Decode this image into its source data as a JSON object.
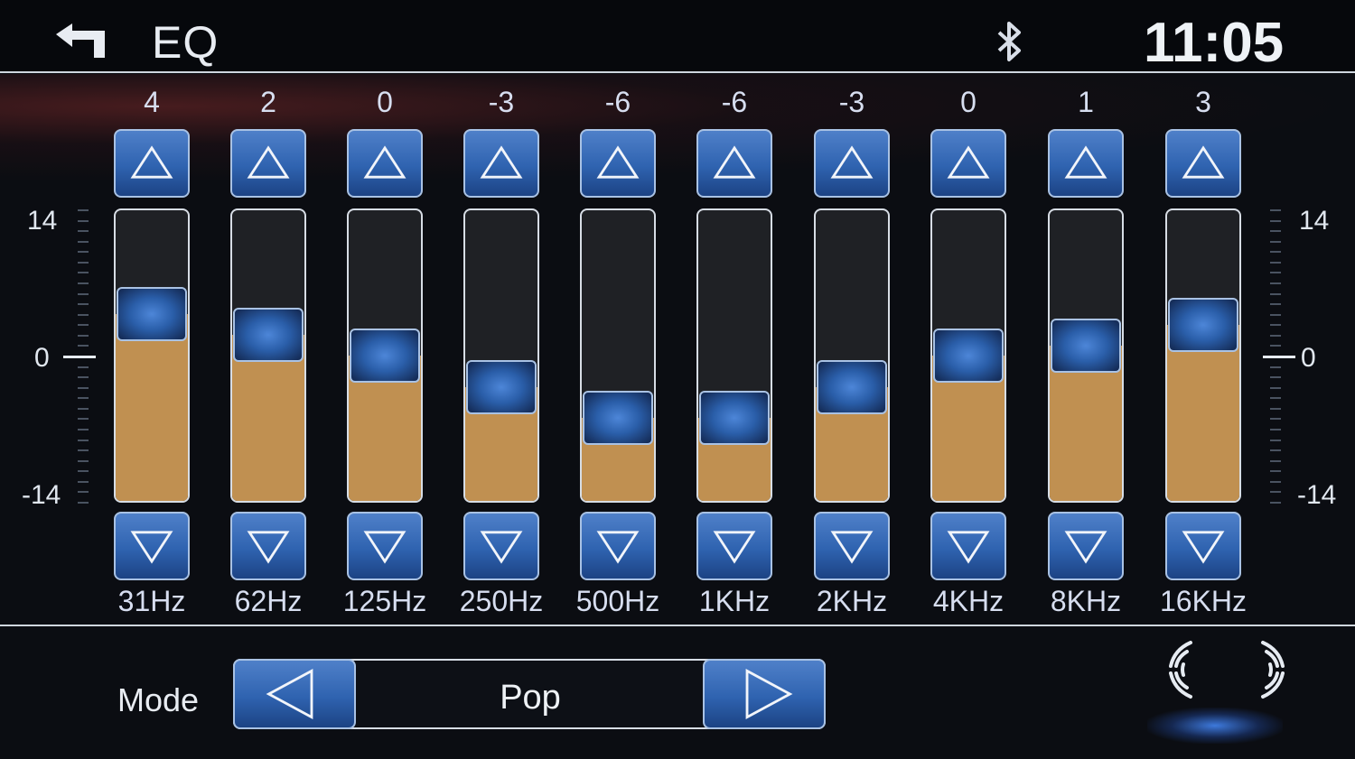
{
  "header": {
    "title": "EQ",
    "clock": "11:05",
    "back_icon": "back-arrow-icon",
    "status_icon": "bluetooth-icon"
  },
  "scale": {
    "max": "14",
    "zero": "0",
    "min": "-14",
    "range": [
      -14,
      14
    ]
  },
  "bands": [
    {
      "freq": "31Hz",
      "value": "4",
      "level": 4
    },
    {
      "freq": "62Hz",
      "value": "2",
      "level": 2
    },
    {
      "freq": "125Hz",
      "value": "0",
      "level": 0
    },
    {
      "freq": "250Hz",
      "value": "-3",
      "level": -3
    },
    {
      "freq": "500Hz",
      "value": "-6",
      "level": -6
    },
    {
      "freq": "1KHz",
      "value": "-6",
      "level": -6
    },
    {
      "freq": "2KHz",
      "value": "-3",
      "level": -3
    },
    {
      "freq": "4KHz",
      "value": "0",
      "level": 0
    },
    {
      "freq": "8KHz",
      "value": "1",
      "level": 1
    },
    {
      "freq": "16KHz",
      "value": "3",
      "level": 3
    }
  ],
  "mode": {
    "label": "Mode",
    "value": "Pop"
  },
  "colors": {
    "accent": "#2f63b0",
    "fill": "#c09051",
    "track": "#1f2125",
    "background": "#0b0d12"
  }
}
